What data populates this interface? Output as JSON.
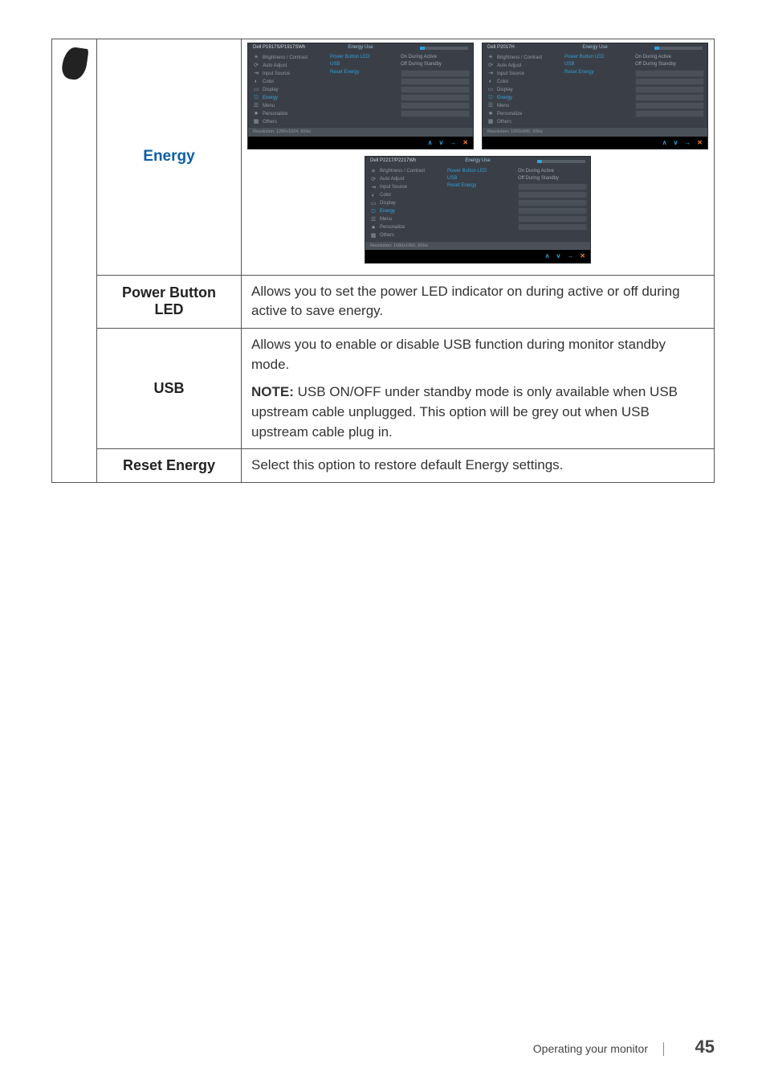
{
  "rows": {
    "energy": {
      "label": "Energy"
    },
    "power_button_led": {
      "label": "Power Button LED",
      "desc": "Allows you to set the power LED indicator on during active or off during active to save energy."
    },
    "usb": {
      "label": "USB",
      "desc1": "Allows you to enable or disable USB function during monitor standby mode.",
      "note_label": "NOTE:",
      "note_body": " USB ON/OFF under standby mode is only available when USB upstream cable unplugged. This option will be grey out when USB upstream cable plug in."
    },
    "reset_energy": {
      "label": "Reset Energy",
      "desc": "Select this option to restore default Energy settings."
    }
  },
  "osd": {
    "models": {
      "a": "Dell P1917S/P1917SWh",
      "b": "Dell P2017H",
      "c": "Dell P2217/P2217Wh"
    },
    "title": "Energy Use",
    "menu": {
      "brightness": "Brightness / Contrast",
      "auto_adjust": "Auto Adjust",
      "input_source": "Input Source",
      "color": "Color",
      "display": "Display",
      "energy": "Energy",
      "menu": "Menu",
      "personalize": "Personalize",
      "others": "Others"
    },
    "options": {
      "power_button_led": "Power Button LED",
      "usb": "USB",
      "reset_energy": "Reset Energy"
    },
    "values": {
      "on_active": "On During Active",
      "off_standby": "Off During Standby"
    },
    "resolutions": {
      "a": "Resolution: 1280x1024, 60Hz",
      "b": "Resolution: 1600x900, 60Hz",
      "c": "Resolution: 1680x1050, 60Hz"
    },
    "nav": {
      "up": "∧",
      "down": "∨",
      "enter": "→",
      "exit": "✕"
    }
  },
  "footer": {
    "section": "Operating your monitor",
    "page": "45"
  }
}
